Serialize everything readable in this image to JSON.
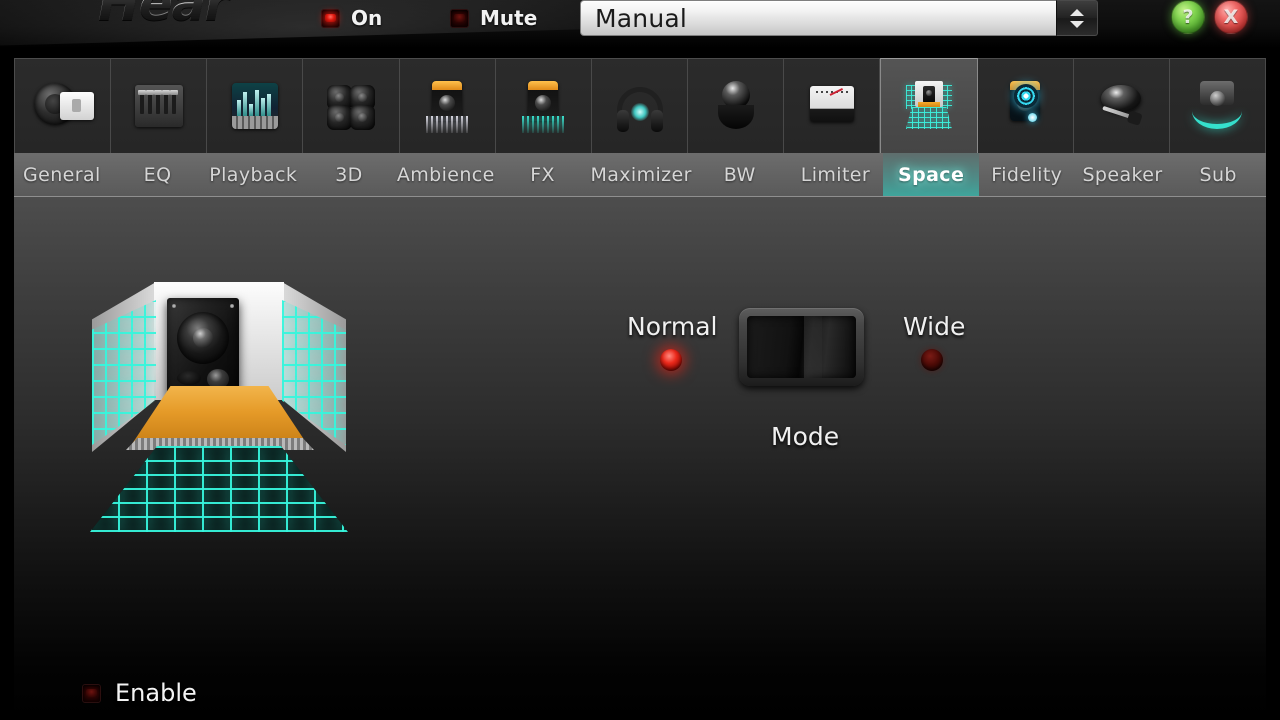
{
  "app": {
    "logo_text": "Hear",
    "brand_accent": "#3fa59c",
    "led_on_color": "#e01a10",
    "led_off_color": "#4e0b07"
  },
  "titlebar": {
    "power": {
      "label": "On",
      "state": "on",
      "icon": "led-square-icon"
    },
    "mute": {
      "label": "Mute",
      "state": "off",
      "icon": "led-square-icon"
    },
    "preset": {
      "value": "Manual",
      "placeholder": "Manual",
      "spinner_up_icon": "triangle-up-icon",
      "spinner_down_icon": "triangle-down-icon"
    },
    "help_button": {
      "label": "?",
      "icon": "help-icon"
    },
    "close_button": {
      "label": "X",
      "icon": "close-icon"
    }
  },
  "tabs": {
    "active_index": 10,
    "items": [
      {
        "label": "General",
        "icon": "general-dial-icon"
      },
      {
        "label": "EQ",
        "icon": "equalizer-mixer-icon"
      },
      {
        "label": "Playback",
        "icon": "spectrum-analyzer-icon"
      },
      {
        "label": "3D",
        "icon": "quad-speakers-icon"
      },
      {
        "label": "Ambience",
        "icon": "amp-silver-spray-icon"
      },
      {
        "label": "FX",
        "icon": "amp-teal-spray-icon"
      },
      {
        "label": "Maximizer",
        "icon": "headphones-icon"
      },
      {
        "label": "BW",
        "icon": "joystick-knob-icon"
      },
      {
        "label": "Limiter",
        "icon": "vu-meter-icon"
      },
      {
        "label": "Space",
        "icon": "room-grid-icon"
      },
      {
        "label": "Fidelity",
        "icon": "concentric-rings-icon"
      },
      {
        "label": "Speaker",
        "icon": "speaker-wrench-icon"
      },
      {
        "label": "Sub",
        "icon": "subwoofer-wave-icon"
      }
    ]
  },
  "main": {
    "illustration": {
      "name": "space-room-illustration",
      "description": "3D room with teal grid floor and walls, speaker on wooden stage"
    },
    "mode_control": {
      "group_label": "Mode",
      "left_option": {
        "label": "Normal",
        "selected": true
      },
      "right_option": {
        "label": "Wide",
        "selected": false
      },
      "switch_icon": "rocker-switch-icon",
      "switch_position": "left"
    }
  },
  "footer": {
    "enable": {
      "label": "Enable",
      "state": "off",
      "icon": "led-square-icon"
    }
  }
}
